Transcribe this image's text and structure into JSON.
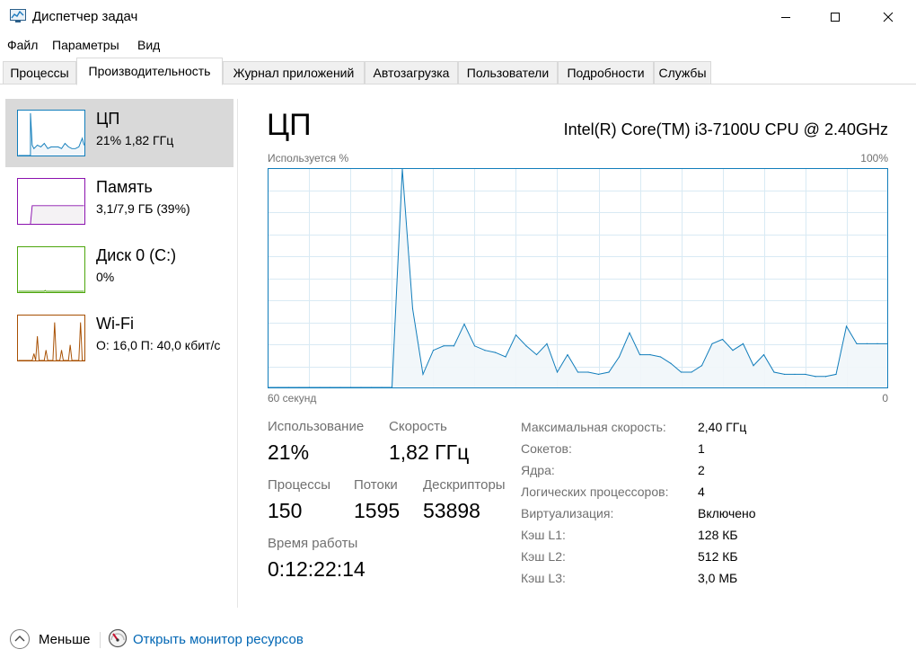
{
  "window": {
    "title": "Диспетчер задач"
  },
  "menu": {
    "items": [
      "Файл",
      "Параметры",
      "Вид"
    ]
  },
  "tabs": [
    {
      "label": "Процессы",
      "active": false
    },
    {
      "label": "Производительность",
      "active": true
    },
    {
      "label": "Журнал приложений",
      "active": false
    },
    {
      "label": "Автозагрузка",
      "active": false
    },
    {
      "label": "Пользователи",
      "active": false
    },
    {
      "label": "Подробности",
      "active": false
    },
    {
      "label": "Службы",
      "active": false
    }
  ],
  "sidebar": {
    "items": [
      {
        "name": "ЦП",
        "sub": "21%  1,82 ГГц",
        "color": "#117dbb",
        "selected": true
      },
      {
        "name": "Память",
        "sub": "3,1/7,9 ГБ (39%)",
        "color": "#8b12ae",
        "selected": false
      },
      {
        "name": "Диск 0 (C:)",
        "sub": "0%",
        "color": "#4da60c",
        "selected": false
      },
      {
        "name": "Wi-Fi",
        "sub": "О: 16,0  П: 40,0 кбит/с",
        "color": "#a74f01",
        "selected": false
      }
    ]
  },
  "main": {
    "title": "ЦП",
    "cpu_model": "Intel(R) Core(TM) i3-7100U CPU @ 2.40GHz",
    "graph": {
      "top_left": "Используется %",
      "top_right": "100%",
      "bottom_left": "60 секунд",
      "bottom_right": "0"
    },
    "stats": {
      "usage_label": "Использование",
      "usage_value": "21%",
      "speed_label": "Скорость",
      "speed_value": "1,82 ГГц",
      "processes_label": "Процессы",
      "processes_value": "150",
      "threads_label": "Потоки",
      "threads_value": "1595",
      "handles_label": "Дескрипторы",
      "handles_value": "53898",
      "uptime_label": "Время работы",
      "uptime_value": "0:12:22:14"
    },
    "specs": [
      {
        "key": "Максимальная скорость:",
        "value": "2,40 ГГц"
      },
      {
        "key": "Сокетов:",
        "value": "1"
      },
      {
        "key": "Ядра:",
        "value": "2"
      },
      {
        "key": "Логических процессоров:",
        "value": "4"
      },
      {
        "key": "Виртуализация:",
        "value": "Включено"
      },
      {
        "key": "Кэш L1:",
        "value": "128 КБ"
      },
      {
        "key": "Кэш L2:",
        "value": "512 КБ"
      },
      {
        "key": "Кэш L3:",
        "value": "3,0 МБ"
      }
    ]
  },
  "footer": {
    "less_label": "Меньше",
    "monitor_label": "Открыть монитор ресурсов"
  },
  "colors": {
    "cpu_line": "#117dbb",
    "cpu_fill": "#f1f6fa",
    "grid": "#d9eaf4",
    "link": "#0066b4",
    "selected_bg": "#d9d9d9"
  },
  "chart_data": {
    "type": "area",
    "x": [
      60,
      59,
      58,
      57,
      56,
      55,
      54,
      53,
      52,
      51,
      50,
      49,
      48,
      47,
      46,
      45,
      44,
      43,
      42,
      41,
      40,
      39,
      38,
      37,
      36,
      35,
      34,
      33,
      32,
      31,
      30,
      29,
      28,
      27,
      26,
      25,
      24,
      23,
      22,
      21,
      20,
      19,
      18,
      17,
      16,
      15,
      14,
      13,
      12,
      11,
      10,
      9,
      8,
      7,
      6,
      5,
      4,
      3,
      2,
      1,
      0
    ],
    "values": [
      0,
      0,
      0,
      0,
      0,
      0,
      0,
      0,
      0,
      0,
      0,
      0,
      0,
      100,
      36,
      6,
      17,
      19,
      19,
      29,
      19,
      17,
      16,
      14,
      24,
      19,
      15,
      20,
      7,
      15,
      7,
      7,
      6,
      7,
      14,
      25,
      15,
      15,
      14,
      11,
      7,
      7,
      10,
      20,
      22,
      17,
      20,
      10,
      15,
      7,
      6,
      6,
      6,
      5,
      5,
      6,
      28,
      20,
      20,
      20,
      20
    ],
    "xlabel": "60 секунд",
    "ylabel": "Используется %",
    "ylim": [
      0,
      100
    ],
    "grid": true
  }
}
